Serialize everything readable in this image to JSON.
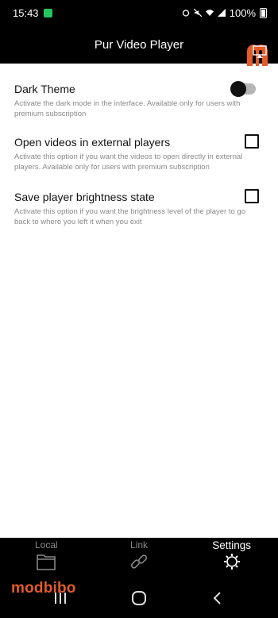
{
  "status": {
    "time": "15:43",
    "battery": "100%"
  },
  "app": {
    "title": "Pur Video Player"
  },
  "settings": [
    {
      "title": "Dark Theme",
      "description": "Activate the dark mode in the interface. Available only for users with premium subscription",
      "control": "toggle",
      "checked": false
    },
    {
      "title": "Open videos in external players",
      "description": "Activate this option if you want the videos to open directly in external players. Available only for users with premium subscription",
      "control": "checkbox",
      "checked": false
    },
    {
      "title": "Save player brightness state",
      "description": "Activate this option if you want the brightness level of the player to go back to where you left it when you exit",
      "control": "checkbox",
      "checked": false
    }
  ],
  "nav": {
    "items": [
      {
        "label": "Local",
        "icon": "folder-icon",
        "active": false
      },
      {
        "label": "Link",
        "icon": "link-icon",
        "active": false
      },
      {
        "label": "Settings",
        "icon": "gear-icon",
        "active": true
      }
    ]
  },
  "watermark": {
    "text": "modbibo",
    "color": "#e25b2b"
  },
  "colors": {
    "bar_bg": "#000000",
    "page_bg": "#ffffff",
    "desc_text": "#8a8a8a"
  }
}
